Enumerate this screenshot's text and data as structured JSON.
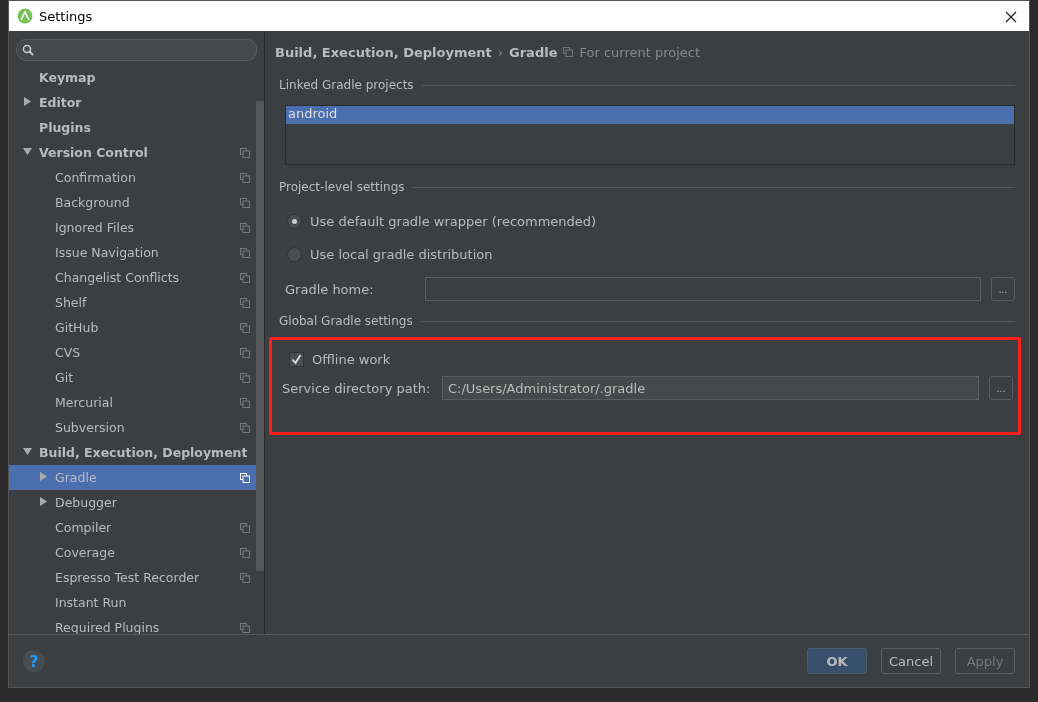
{
  "window": {
    "title": "Settings"
  },
  "help": {
    "label": "?"
  },
  "tree": [
    {
      "label": "Keymap",
      "project_icon": false,
      "selected": false
    },
    {
      "label": "Editor",
      "expanded": false,
      "project_icon": false,
      "selected": false
    },
    {
      "label": "Plugins",
      "project_icon": false,
      "selected": false
    },
    {
      "label": "Version Control",
      "expanded": true,
      "project_icon": true,
      "selected": false,
      "children": [
        {
          "label": "Confirmation",
          "project_icon": true,
          "selected": false
        },
        {
          "label": "Background",
          "project_icon": true,
          "selected": false
        },
        {
          "label": "Ignored Files",
          "project_icon": true,
          "selected": false
        },
        {
          "label": "Issue Navigation",
          "project_icon": true,
          "selected": false
        },
        {
          "label": "Changelist Conflicts",
          "project_icon": true,
          "selected": false
        },
        {
          "label": "Shelf",
          "project_icon": true,
          "selected": false
        },
        {
          "label": "GitHub",
          "project_icon": true,
          "selected": false
        },
        {
          "label": "CVS",
          "project_icon": true,
          "selected": false
        },
        {
          "label": "Git",
          "project_icon": true,
          "selected": false
        },
        {
          "label": "Mercurial",
          "project_icon": true,
          "selected": false
        },
        {
          "label": "Subversion",
          "project_icon": true,
          "selected": false
        }
      ]
    },
    {
      "label": "Build, Execution, Deployment",
      "expanded": true,
      "project_icon": false,
      "selected": false,
      "children": [
        {
          "label": "Gradle",
          "expanded": false,
          "project_icon": true,
          "selected": true
        },
        {
          "label": "Debugger",
          "expanded": false,
          "project_icon": false,
          "selected": false
        },
        {
          "label": "Compiler",
          "project_icon": true,
          "selected": false
        },
        {
          "label": "Coverage",
          "project_icon": true,
          "selected": false
        },
        {
          "label": "Espresso Test Recorder",
          "project_icon": true,
          "selected": false
        },
        {
          "label": "Instant Run",
          "project_icon": false,
          "selected": false
        },
        {
          "label": "Required Plugins",
          "project_icon": true,
          "selected": false
        }
      ]
    }
  ],
  "breadcrumb": {
    "parent": "Build, Execution, Deployment",
    "separator": "›",
    "current": "Gradle",
    "scope": "For current project"
  },
  "linked_projects": {
    "title": "Linked Gradle projects",
    "items": [
      {
        "label": "android",
        "selected": true
      }
    ]
  },
  "project_settings": {
    "title": "Project-level settings",
    "options": [
      {
        "label": "Use default gradle wrapper (recommended)",
        "selected": true
      },
      {
        "label": "Use local gradle distribution",
        "selected": false
      }
    ],
    "gradle_home": {
      "label": "Gradle home:",
      "browse": "..."
    }
  },
  "global_settings": {
    "title": "Global Gradle settings",
    "highlighted": true,
    "offline": {
      "label": "Offline work",
      "checked": true
    },
    "service_dir": {
      "label": "Service directory path:",
      "value": "C:/Users/Administrator/.gradle",
      "browse": "..."
    }
  },
  "buttons": [
    {
      "label": "OK",
      "kind": "default"
    },
    {
      "label": "Cancel",
      "kind": "normal"
    },
    {
      "label": "Apply",
      "kind": "disabled"
    }
  ]
}
